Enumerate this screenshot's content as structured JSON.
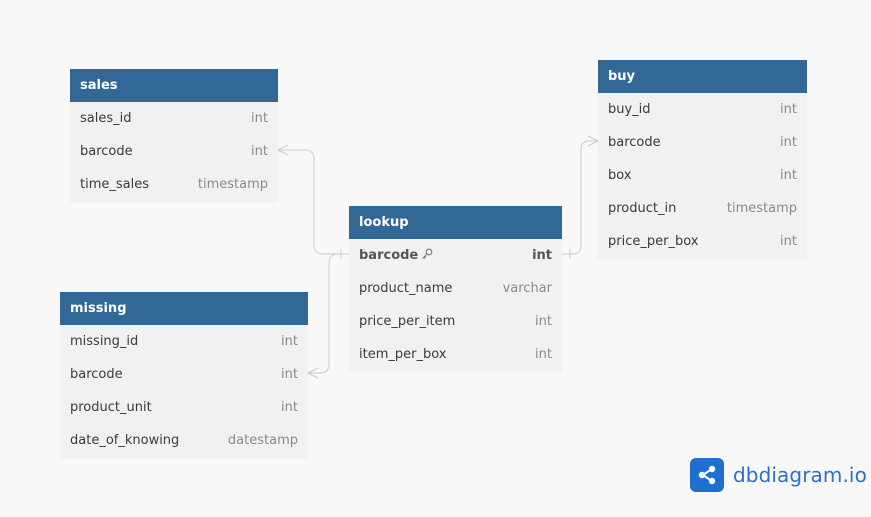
{
  "tables": {
    "sales": {
      "name": "sales",
      "fields": [
        {
          "name": "sales_id",
          "type": "int"
        },
        {
          "name": "barcode",
          "type": "int"
        },
        {
          "name": "time_sales",
          "type": "timestamp"
        }
      ]
    },
    "missing": {
      "name": "missing",
      "fields": [
        {
          "name": "missing_id",
          "type": "int"
        },
        {
          "name": "barcode",
          "type": "int"
        },
        {
          "name": "product_unit",
          "type": "int"
        },
        {
          "name": "date_of_knowing",
          "type": "datestamp"
        }
      ]
    },
    "lookup": {
      "name": "lookup",
      "fields": [
        {
          "name": "barcode",
          "type": "int"
        },
        {
          "name": "product_name",
          "type": "varchar"
        },
        {
          "name": "price_per_item",
          "type": "int"
        },
        {
          "name": "item_per_box",
          "type": "int"
        }
      ]
    },
    "buy": {
      "name": "buy",
      "fields": [
        {
          "name": "buy_id",
          "type": "int"
        },
        {
          "name": "barcode",
          "type": "int"
        },
        {
          "name": "box",
          "type": "int"
        },
        {
          "name": "product_in",
          "type": "timestamp"
        },
        {
          "name": "price_per_box",
          "type": "int"
        }
      ]
    }
  },
  "relationships": [
    {
      "from": "sales.barcode",
      "to": "lookup.barcode",
      "type": "many-to-one"
    },
    {
      "from": "missing.barcode",
      "to": "lookup.barcode",
      "type": "many-to-one"
    },
    {
      "from": "lookup.barcode",
      "to": "buy.barcode",
      "type": "one-to-many"
    }
  ],
  "branding": {
    "logo_text": "dbdiagram.io",
    "logo_icon": "share-nodes-icon"
  },
  "colors": {
    "header_bg": "#316896",
    "header_text": "#ffffff",
    "table_bg": "#f1f1f2",
    "canvas_bg": "#f8f8f9",
    "connector": "#c9c9c9",
    "brand": "#1f6fd1"
  }
}
